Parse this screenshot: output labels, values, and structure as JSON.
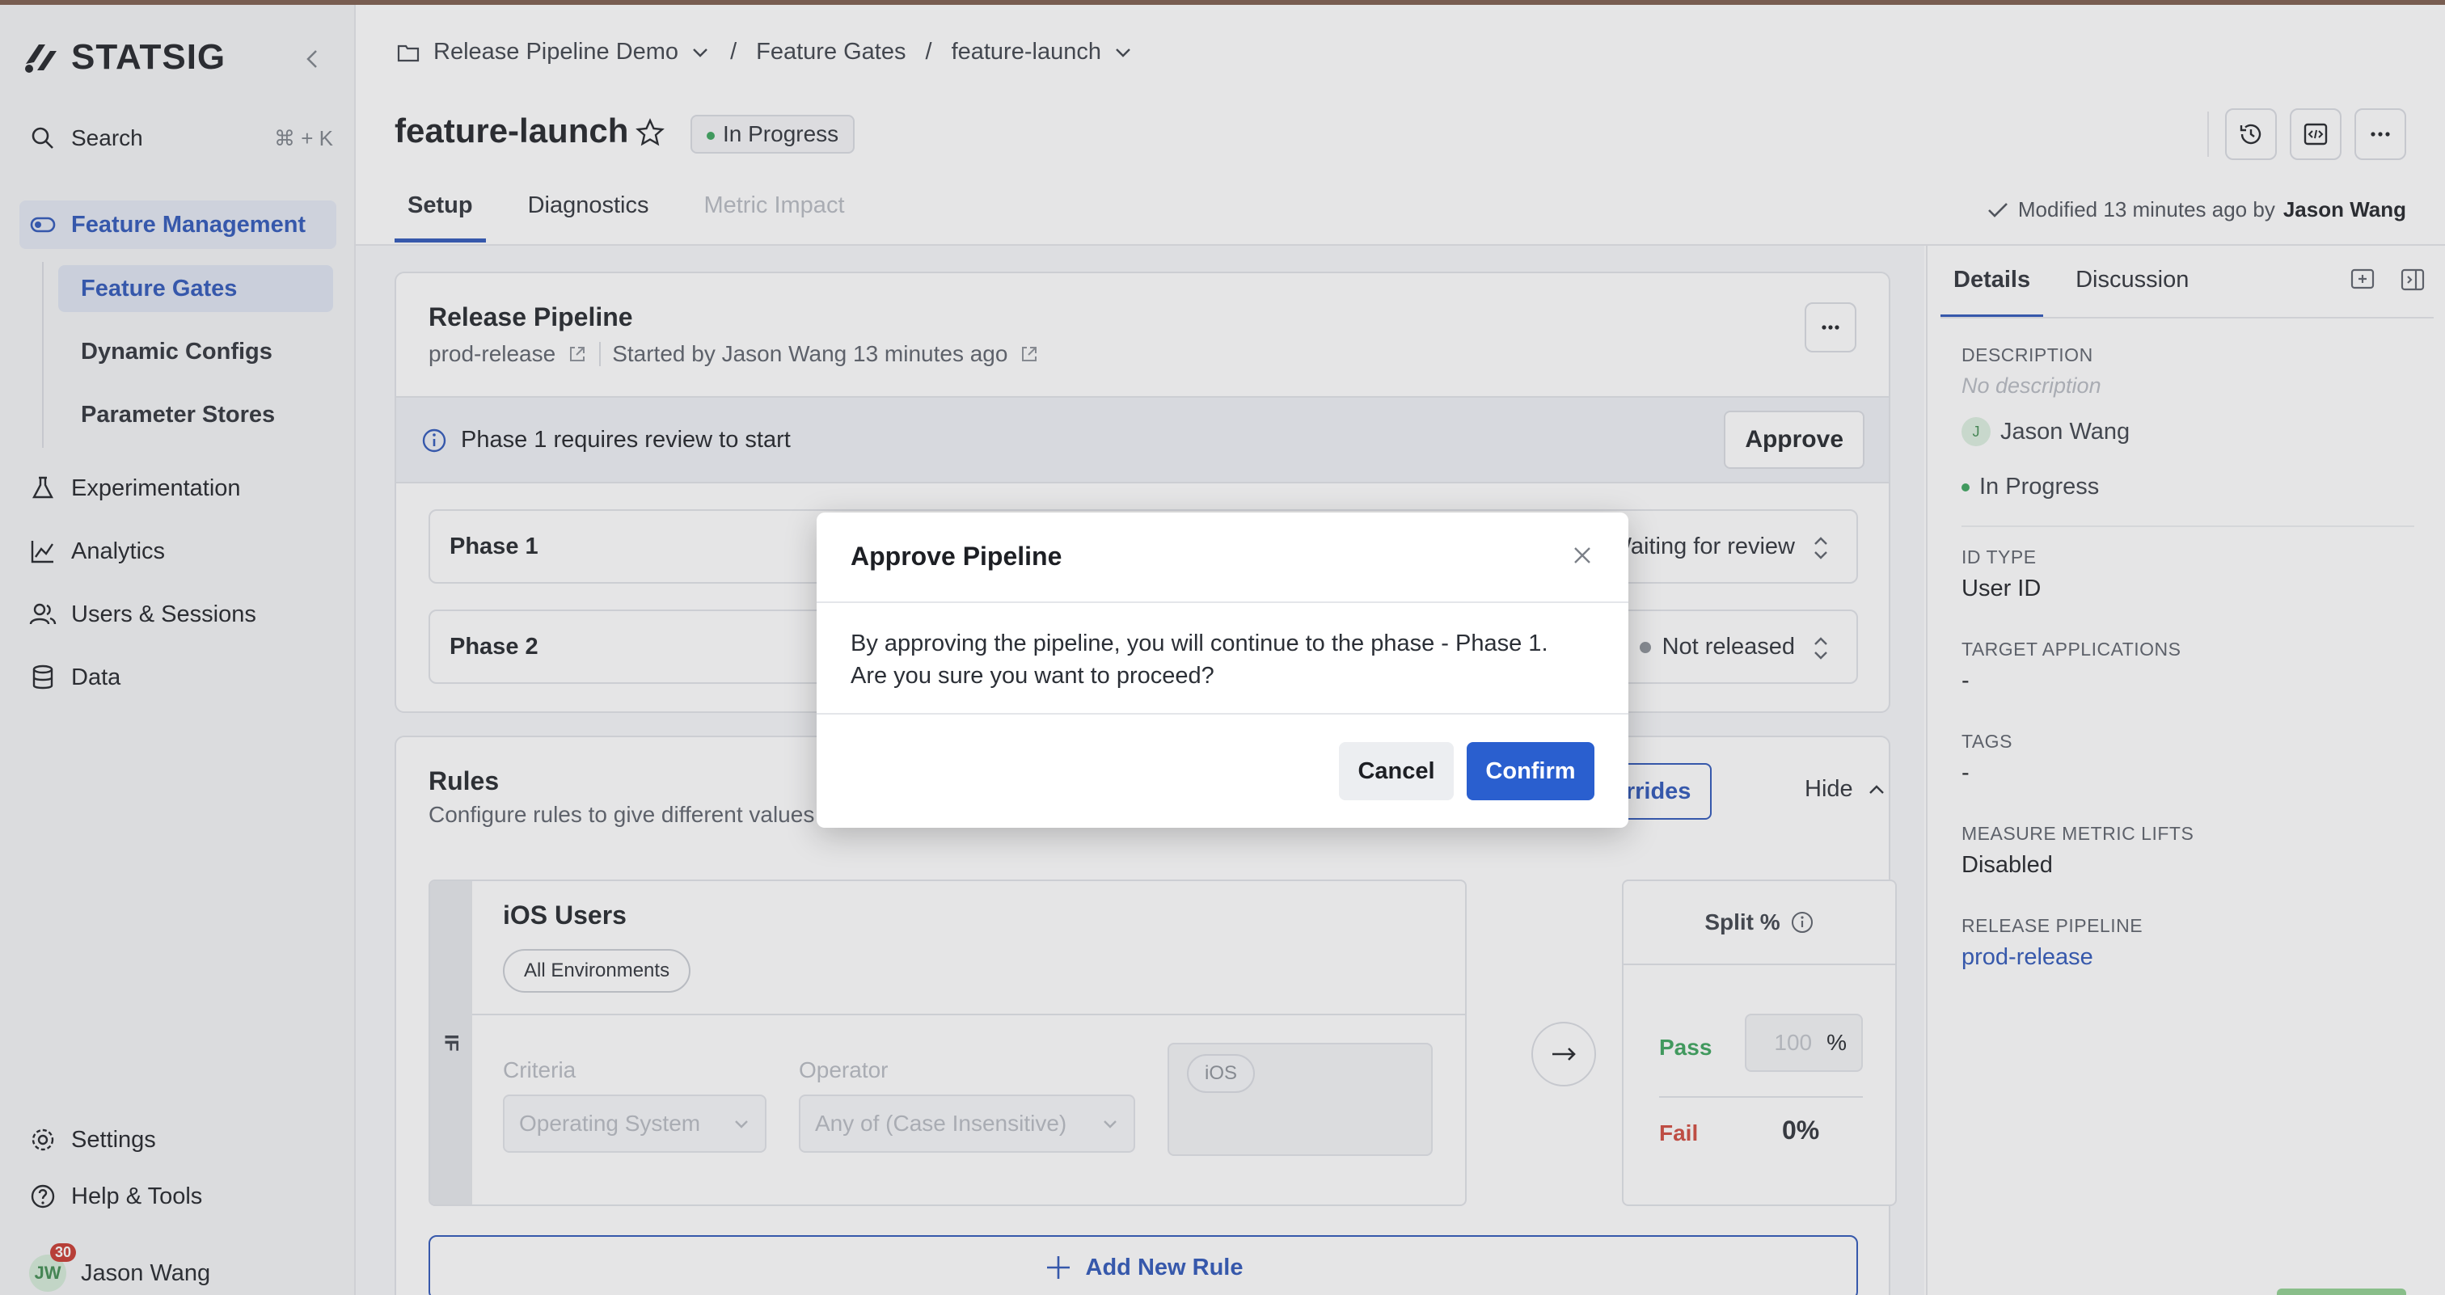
{
  "brand": {
    "name": "STATSIG"
  },
  "sidebar": {
    "search_label": "Search",
    "search_shortcut": "⌘ + K",
    "feature_management": "Feature Management",
    "sub_items": [
      "Feature Gates",
      "Dynamic Configs",
      "Parameter Stores"
    ],
    "experimentation": "Experimentation",
    "analytics": "Analytics",
    "users_sessions": "Users & Sessions",
    "data": "Data",
    "settings": "Settings",
    "help": "Help & Tools",
    "user": {
      "initials": "JW",
      "name": "Jason Wang",
      "badge": "30"
    }
  },
  "breadcrumb": {
    "project": "Release Pipeline Demo",
    "section": "Feature Gates",
    "current": "feature-launch"
  },
  "header": {
    "title": "feature-launch",
    "status": "In Progress",
    "tabs": [
      "Setup",
      "Diagnostics",
      "Metric Impact"
    ],
    "modified_prefix": "Modified 13 minutes ago by",
    "modified_by": "Jason Wang"
  },
  "release_pipeline": {
    "title": "Release Pipeline",
    "pipeline_name": "prod-release",
    "started_by": "Started by Jason Wang 13 minutes ago",
    "review_text": "Phase 1 requires review to start",
    "approve_label": "Approve",
    "phases": [
      {
        "name": "Phase 1",
        "status": "Waiting for review"
      },
      {
        "name": "Phase 2",
        "status": "Not released"
      }
    ]
  },
  "rules": {
    "title": "Rules",
    "subtitle": "Configure rules to give different values",
    "overrides_label": "Overrides",
    "hide_label": "Hide",
    "rule": {
      "if_label": "IF",
      "name": "iOS Users",
      "environment": "All Environments",
      "criteria_label": "Criteria",
      "criteria_value": "Operating System",
      "operator_label": "Operator",
      "operator_value": "Any of (Case Insensitive)",
      "value_tag": "iOS"
    },
    "split": {
      "title": "Split %",
      "pass_label": "Pass",
      "pass_placeholder": "100",
      "pass_unit": "%",
      "fail_label": "Fail",
      "fail_value": "0%"
    },
    "add_rule_label": "Add New Rule"
  },
  "details_panel": {
    "tabs": [
      "Details",
      "Discussion"
    ],
    "description_label": "DESCRIPTION",
    "description_value": "No description",
    "owner": {
      "initial": "J",
      "name": "Jason Wang"
    },
    "status": "In Progress",
    "id_type_label": "ID TYPE",
    "id_type_value": "User ID",
    "target_apps_label": "TARGET APPLICATIONS",
    "target_apps_value": "-",
    "tags_label": "TAGS",
    "tags_value": "-",
    "measure_label": "MEASURE METRIC LIFTS",
    "measure_value": "Disabled",
    "pipeline_label": "RELEASE PIPELINE",
    "pipeline_value": "prod-release"
  },
  "modal": {
    "title": "Approve Pipeline",
    "body_line1": "By approving the pipeline, you will continue to the phase - Phase 1.",
    "body_line2": "Are you sure you want to proceed?",
    "cancel_label": "Cancel",
    "confirm_label": "Confirm"
  },
  "colors": {
    "accent": "#2a53b8",
    "confirm": "#2a5fcf",
    "pass": "#38a35a",
    "fail": "#d0463a"
  }
}
